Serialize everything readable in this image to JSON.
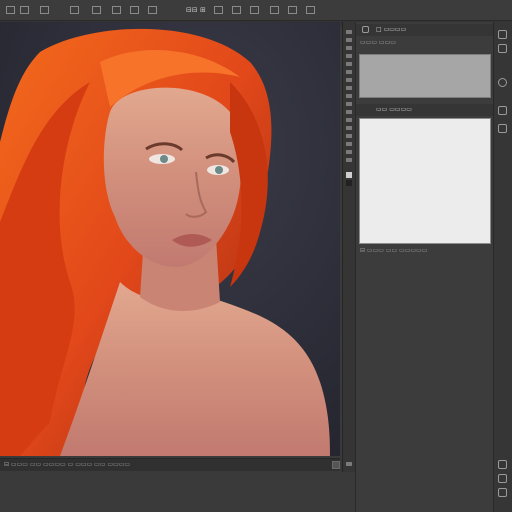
{
  "menubar": {
    "items": [
      "≡",
      "⊟",
      "⊡",
      "◫",
      "▭",
      "⊠",
      "▤",
      "⊞",
      "⊟⊟ ⊞"
    ]
  },
  "status": {
    "text": "⊟ ▭▭▭ ▭▭ ▭▭▭▭ ▭ ▭▭▭ ▭▭ ▭▭▭▭"
  },
  "panels": {
    "top_title": "□ ▭▭▭▭",
    "top_subtitle": "▭▭▭ ▭▭▭",
    "layers_title": "▭▭ ▭▭▭▭",
    "bottom_label": "⊟ ▭▭▭ ▭▭ ▭▭▭▭▭"
  },
  "colors": {
    "hair": "#e2481a",
    "skin": "#d9907a",
    "background": "#2a2c37",
    "panel_grey": "#a6a6a6",
    "panel_white": "#ececec"
  }
}
